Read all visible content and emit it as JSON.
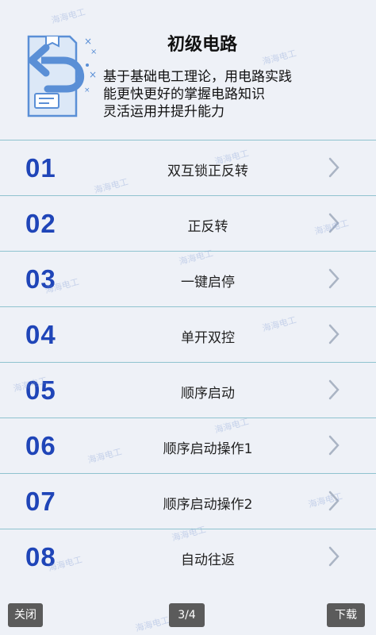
{
  "header": {
    "title": "初级电路",
    "description_lines": [
      "基于基础电工理论，用电路实践",
      "能更快更好的掌握电路知识",
      "灵活运用并提升能力"
    ]
  },
  "watermark": "海海电工",
  "items": [
    {
      "number": "01",
      "label": "双互锁正反转"
    },
    {
      "number": "02",
      "label": "正反转"
    },
    {
      "number": "03",
      "label": "一键启停"
    },
    {
      "number": "04",
      "label": "单开双控"
    },
    {
      "number": "05",
      "label": "顺序启动"
    },
    {
      "number": "06",
      "label": "顺序启动操作1"
    },
    {
      "number": "07",
      "label": "顺序启动操作2"
    },
    {
      "number": "08",
      "label": "自动往返"
    }
  ],
  "bottom": {
    "close_label": "关闭",
    "page_indicator": "3/4",
    "download_label": "下载"
  },
  "colors": {
    "number": "#1f45b8",
    "divider": "#8fc3cf",
    "bar_button": "#5b5b5b"
  },
  "icons": {
    "chevron": "chevron-right-icon",
    "illustration": "return-box-illustration"
  }
}
